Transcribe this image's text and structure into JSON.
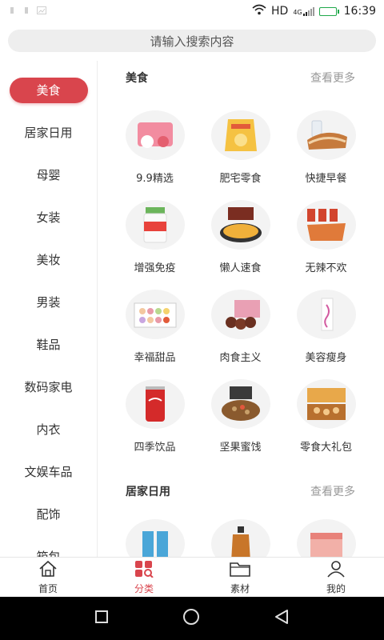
{
  "status": {
    "network": "HD",
    "network_gen": "4G",
    "time": "16:39",
    "battery_level": 0.95,
    "left_icons": [
      "notification-icon",
      "notification-icon",
      "image-icon"
    ]
  },
  "search": {
    "placeholder": "请输入搜索内容"
  },
  "sidebar": {
    "items": [
      {
        "label": "美食",
        "active": true
      },
      {
        "label": "居家日用"
      },
      {
        "label": "母婴"
      },
      {
        "label": "女装"
      },
      {
        "label": "美妆"
      },
      {
        "label": "男装"
      },
      {
        "label": "鞋品"
      },
      {
        "label": "数码家电"
      },
      {
        "label": "内衣"
      },
      {
        "label": "文娱车品"
      },
      {
        "label": "配饰"
      },
      {
        "label": "箱包"
      }
    ]
  },
  "sections": [
    {
      "title": "美食",
      "more": "查看更多",
      "items": [
        {
          "label": "9.9精选"
        },
        {
          "label": "肥宅零食"
        },
        {
          "label": "快捷早餐"
        },
        {
          "label": "增强免疫"
        },
        {
          "label": "懒人速食"
        },
        {
          "label": "无辣不欢"
        },
        {
          "label": "幸福甜品"
        },
        {
          "label": "肉食主义"
        },
        {
          "label": "美容瘦身"
        },
        {
          "label": "四季饮品"
        },
        {
          "label": "坚果蜜饯"
        },
        {
          "label": "零食大礼包"
        }
      ]
    },
    {
      "title": "居家日用",
      "more": "查看更多"
    }
  ],
  "tabs": [
    {
      "label": "首页",
      "icon": "home-icon"
    },
    {
      "label": "分类",
      "icon": "category-icon",
      "active": true
    },
    {
      "label": "素材",
      "icon": "folder-icon"
    },
    {
      "label": "我的",
      "icon": "user-icon"
    }
  ],
  "colors": {
    "accent": "#d9454d",
    "muted": "#999999"
  }
}
